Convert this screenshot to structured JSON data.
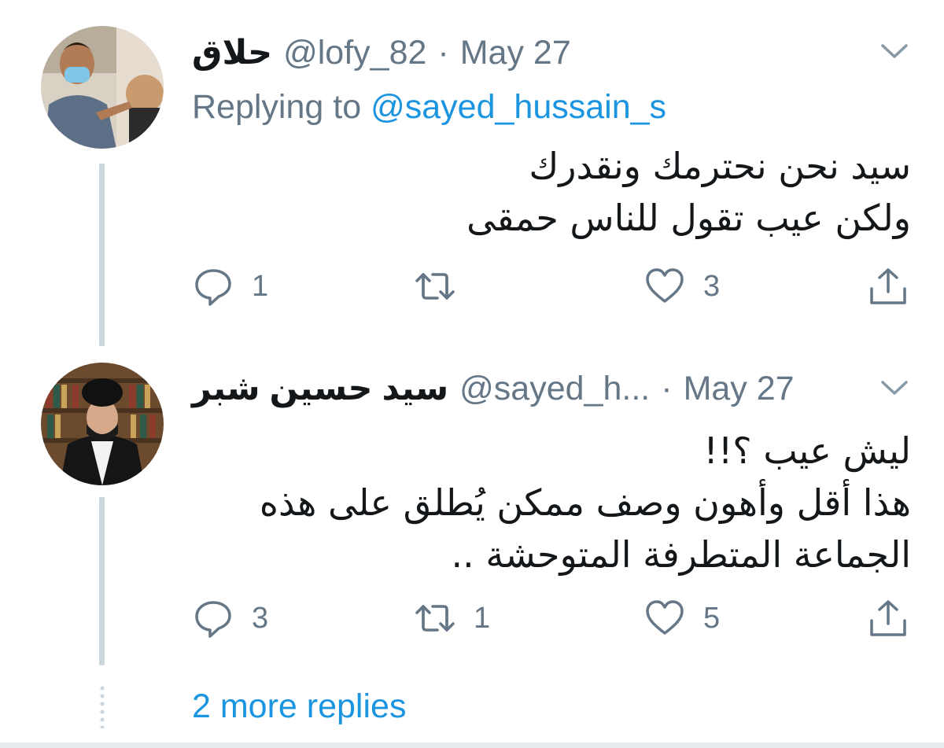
{
  "tweets": [
    {
      "name": "حلاق",
      "handle": "@lofy_82",
      "separator": "·",
      "date": "May 27",
      "replying_prefix": "Replying to",
      "replying_mention": "@sayed_hussain_s",
      "text_lines": [
        "سيد نحن نحترمك ونقدرك",
        "ولكن عيب تقول للناس حمقى"
      ],
      "reply_count": "1",
      "retweet_count": "",
      "like_count": "3"
    },
    {
      "name": "سيد حسين شبر",
      "handle": "@sayed_h...",
      "separator": "·",
      "date": "May 27",
      "text_lines": [
        "ليش عيب ؟!!",
        "هذا أقل وأهون وصف ممكن يُطلق على هذه",
        "الجماعة المتطرفة المتوحشة .."
      ],
      "reply_count": "3",
      "retweet_count": "1",
      "like_count": "5"
    }
  ],
  "more_replies_label": "2 more replies",
  "icons": {
    "reply": "reply-icon",
    "retweet": "retweet-icon",
    "like": "heart-icon",
    "share": "share-icon",
    "menu": "chevron-down-icon"
  },
  "colors": {
    "link": "#1b95e0",
    "secondary_text": "#657786",
    "primary_text": "#14171a",
    "thread_line": "#ccd6dd"
  }
}
